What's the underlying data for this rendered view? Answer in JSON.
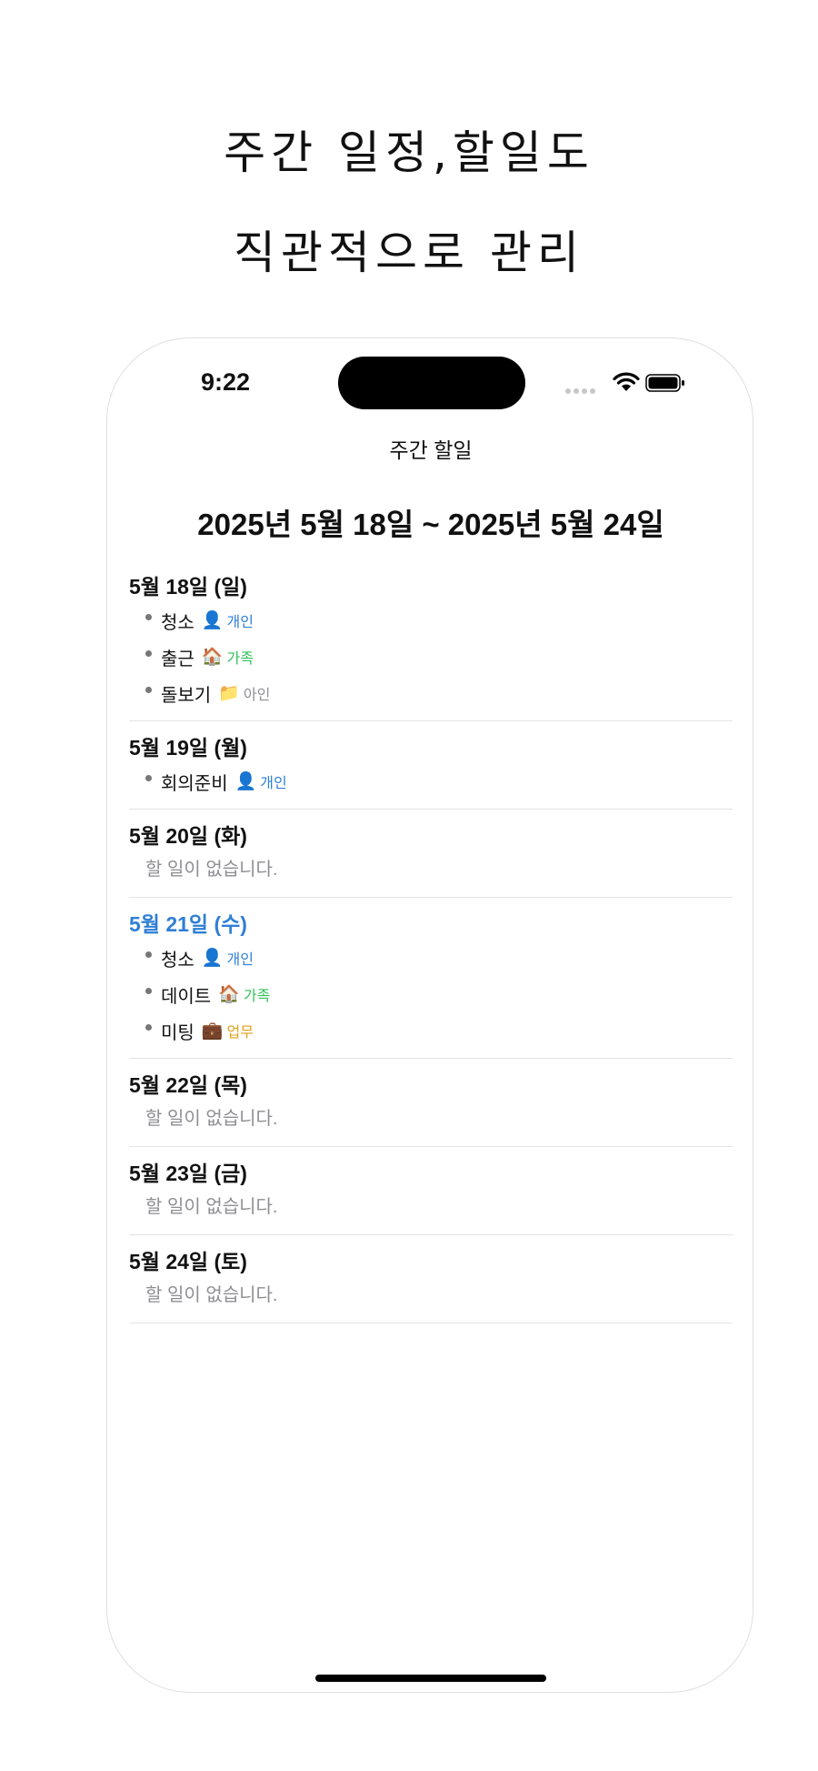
{
  "hero": {
    "line1": "주간 일정,할일도",
    "line2": "직관적으로 관리"
  },
  "status_bar": {
    "time": "9:22"
  },
  "nav": {
    "title": "주간 할일"
  },
  "week_range": "2025년 5월 18일 ~ 2025년 5월 24일",
  "empty_label": "할 일이 없습니다.",
  "colors": {
    "today": "#2f7fd6",
    "personal": "#2f7fd6",
    "family": "#32c25a",
    "other": "#8e8e93",
    "work": "#e3a11a"
  },
  "days": [
    {
      "label": "5월 18일 (일)",
      "today": false,
      "tasks": [
        {
          "name": "청소",
          "icon": "person-icon",
          "glyph": "👤",
          "category": "개인",
          "color": "blue"
        },
        {
          "name": "출근",
          "icon": "house-icon",
          "glyph": "🏠",
          "category": "가족",
          "color": "green"
        },
        {
          "name": "돌보기",
          "icon": "folder-icon",
          "glyph": "📁",
          "category": "아인",
          "color": "gray"
        }
      ]
    },
    {
      "label": "5월 19일 (월)",
      "today": false,
      "tasks": [
        {
          "name": "회의준비",
          "icon": "person-icon",
          "glyph": "👤",
          "category": "개인",
          "color": "blue"
        }
      ]
    },
    {
      "label": "5월 20일 (화)",
      "today": false,
      "tasks": []
    },
    {
      "label": "5월 21일 (수)",
      "today": true,
      "tasks": [
        {
          "name": "청소",
          "icon": "person-icon",
          "glyph": "👤",
          "category": "개인",
          "color": "blue"
        },
        {
          "name": "데이트",
          "icon": "house-icon",
          "glyph": "🏠",
          "category": "가족",
          "color": "green"
        },
        {
          "name": "미팅",
          "icon": "briefcase-icon",
          "glyph": "💼",
          "category": "업무",
          "color": "orange"
        }
      ]
    },
    {
      "label": "5월 22일 (목)",
      "today": false,
      "tasks": []
    },
    {
      "label": "5월 23일 (금)",
      "today": false,
      "tasks": []
    },
    {
      "label": "5월 24일 (토)",
      "today": false,
      "tasks": []
    }
  ]
}
